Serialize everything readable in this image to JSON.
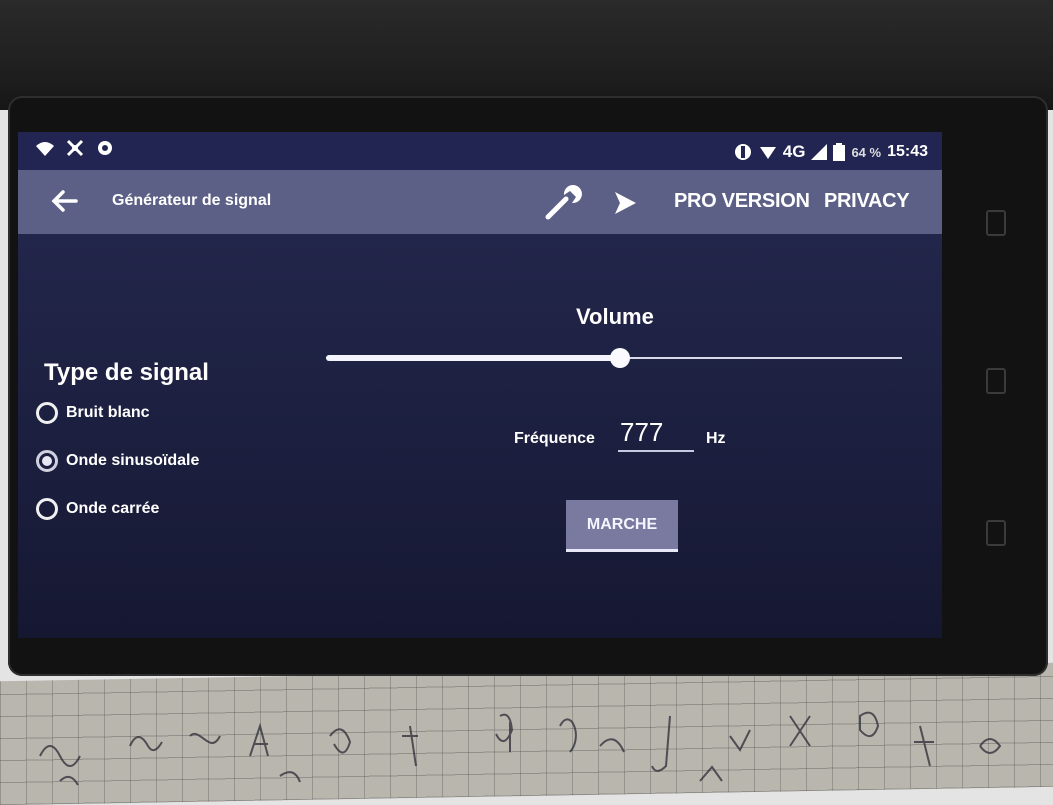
{
  "status_bar": {
    "network": "4G",
    "battery_percent": "64 %",
    "time": "15:43"
  },
  "toolbar": {
    "title": "Générateur de signal",
    "pro_version": "PRO VERSION",
    "privacy": "PRIVACY"
  },
  "main": {
    "volume_label": "Volume",
    "volume_level": 0.51,
    "signal_type_title": "Type de signal",
    "signal_types": [
      {
        "label": "Bruit blanc",
        "checked": false
      },
      {
        "label": "Onde sinusoïdale",
        "checked": true
      },
      {
        "label": "Onde carrée",
        "checked": false
      }
    ],
    "frequency_label": "Fréquence",
    "frequency_value": "777",
    "frequency_unit": "Hz",
    "start_button": "MARCHE"
  },
  "colors": {
    "toolbar": "#5d6086",
    "status_bar": "#222552",
    "content_bg": "#1c1f3f",
    "button_bg": "#7a7aa0"
  }
}
